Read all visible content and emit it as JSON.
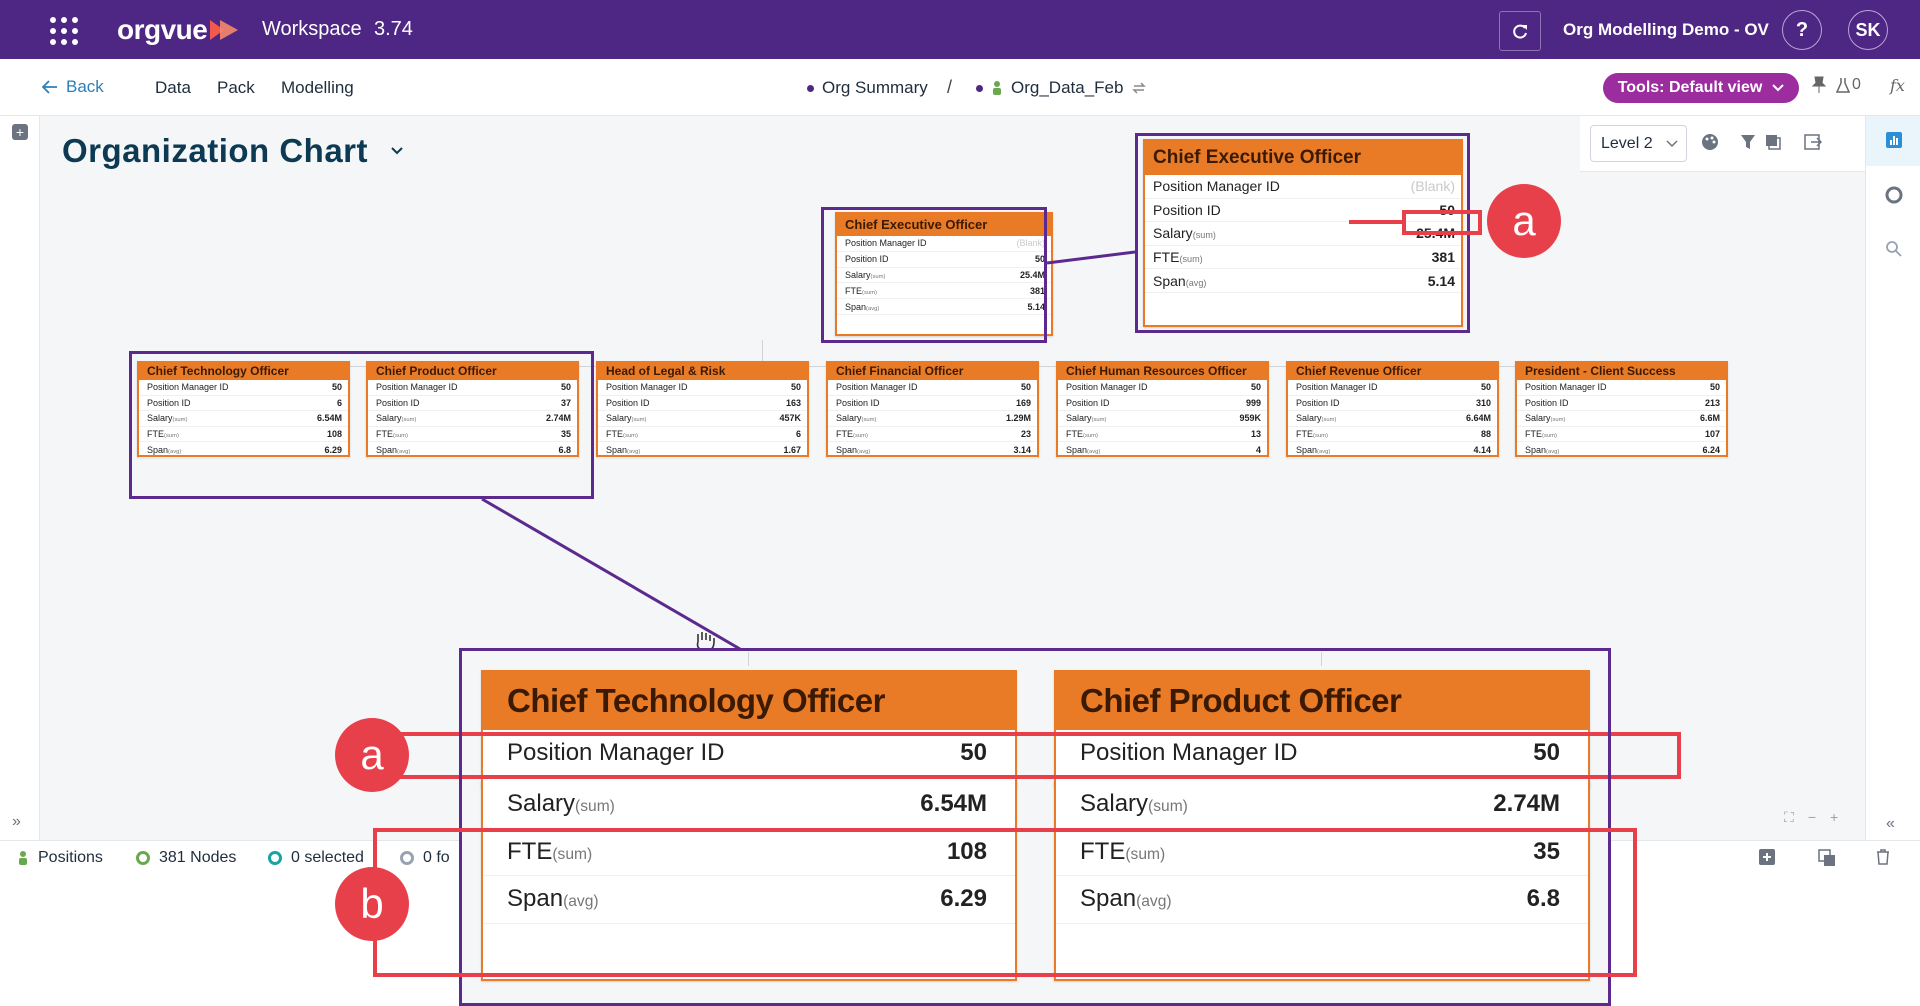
{
  "app": {
    "brand": "orgvue",
    "workspace_title": "Workspace",
    "version": "3.74",
    "dataset_name": "Org Modelling Demo - OV",
    "help_label": "?",
    "user_initials": "SK"
  },
  "nav": {
    "back_label": "Back",
    "items": [
      "Data",
      "Pack",
      "Modelling"
    ],
    "breadcrumb": [
      "Org Summary",
      "Org_Data_Feb"
    ],
    "separator": "/",
    "tools_label": "Tools: Default view",
    "flask_count": "0",
    "fx_label": "fx"
  },
  "page": {
    "title": "Organization Chart",
    "level_select": "Level 2"
  },
  "field_labels": {
    "manager": "Position Manager ID",
    "position": "Position ID",
    "salary": "Salary",
    "fte": "FTE",
    "span": "Span",
    "sum": "(sum)",
    "avg": "(avg)"
  },
  "ceo": {
    "title": "Chief Executive Officer",
    "manager_id": "(Blank)",
    "position_id": "50",
    "salary": "25.4M",
    "fte": "381",
    "span": "5.14"
  },
  "reports": [
    {
      "title": "Chief Technology Officer",
      "manager_id": "50",
      "position_id": "6",
      "salary": "6.54M",
      "fte": "108",
      "span": "6.29"
    },
    {
      "title": "Chief Product Officer",
      "manager_id": "50",
      "position_id": "37",
      "salary": "2.74M",
      "fte": "35",
      "span": "6.8"
    },
    {
      "title": "Head of Legal & Risk",
      "manager_id": "50",
      "position_id": "163",
      "salary": "457K",
      "fte": "6",
      "span": "1.67"
    },
    {
      "title": "Chief Financial Officer",
      "manager_id": "50",
      "position_id": "169",
      "salary": "1.29M",
      "fte": "23",
      "span": "3.14"
    },
    {
      "title": "Chief Human Resources Officer",
      "manager_id": "50",
      "position_id": "999",
      "salary": "959K",
      "fte": "13",
      "span": "4"
    },
    {
      "title": "Chief Revenue Officer",
      "manager_id": "50",
      "position_id": "310",
      "salary": "6.64M",
      "fte": "88",
      "span": "4.14"
    },
    {
      "title": "President -  Client Success",
      "manager_id": "50",
      "position_id": "213",
      "salary": "6.6M",
      "fte": "107",
      "span": "6.24"
    }
  ],
  "annotations": {
    "a": "a",
    "b": "b"
  },
  "status": {
    "positions": "Positions",
    "nodes": "381 Nodes",
    "selected": "0 selected",
    "focused": "0 fo"
  },
  "icons": {
    "apps": "apps-grid-icon",
    "sync": "sync-icon",
    "pin": "pin-icon",
    "flask": "flask-icon",
    "palette": "palette-icon",
    "filter": "filter-icon",
    "export": "export-icon"
  },
  "colors": {
    "brand_purple": "#4e2683",
    "card_orange": "#e97b27",
    "tools_magenta": "#9b2d9f",
    "highlight_red": "#e8404a",
    "highlight_purple": "#5c2a8f"
  }
}
